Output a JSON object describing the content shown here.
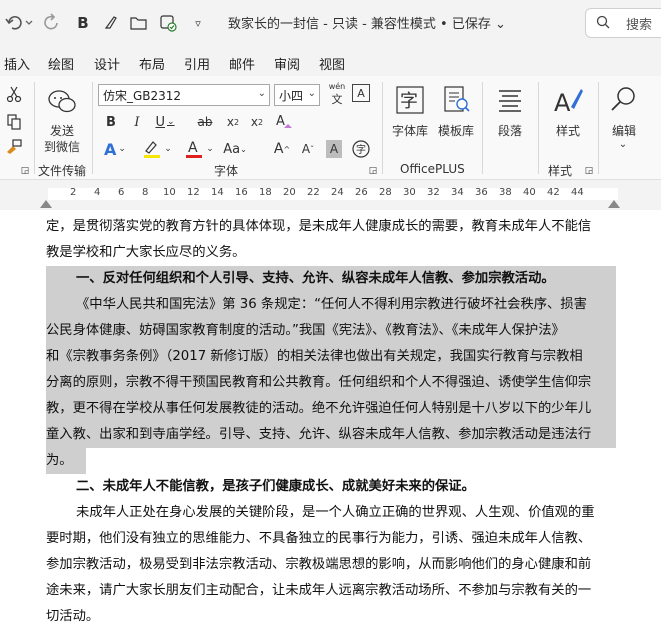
{
  "titlebar": {
    "document_title": "致家长的一封信  -  只读  -  兼容性模式 • 已保存 ⌄",
    "search_label": "搜索"
  },
  "menu": {
    "tabs": [
      "插入",
      "绘图",
      "设计",
      "布局",
      "引用",
      "邮件",
      "审阅",
      "视图"
    ]
  },
  "ribbon": {
    "send_wechat_line1": "发送",
    "send_wechat_line2": "到微信",
    "file_transfer_group": "文件传输",
    "font_name": "仿宋_GB2312",
    "font_size": "小四",
    "wen_label": "wén",
    "font_group": "字体",
    "font_lib": "字体库",
    "template_lib": "模板库",
    "officeplus_group": "OfficePLUS",
    "paragraph": "段落",
    "style": "样式",
    "style_group": "样式",
    "edit": "编辑"
  },
  "ruler": {
    "numbers": [
      "2",
      "4",
      "6",
      "8",
      "10",
      "12",
      "14",
      "16",
      "18",
      "20",
      "22",
      "24",
      "26",
      "28",
      "30",
      "32",
      "34",
      "36",
      "38",
      "40",
      "42",
      "44"
    ]
  },
  "document": {
    "lines": [
      "定，是贯彻落实党的教育方针的具体体现，是未成年人健康成长的需要，教育未成年人不能信",
      "教是学校和广大家长应尽的义务。",
      "一、反对任何组织和个人引导、支持、允许、纵容未成年人信教、参加宗教活动。",
      "《中华人民共和国宪法》第 36 条规定：“任何人不得利用宗教进行破坏社会秩序、损害",
      "公民身体健康、妨碍国家教育制度的活动。”我国《宪法》、《教育法》、《未成年人保护法》",
      "和《宗教事务条例》（2017 新修订版）的相关法律也做出有关规定，我国实行教育与宗教相",
      "分离的原则，宗教不得干预国民教育和公共教育。任何组织和个人不得强迫、诱使学生信仰宗",
      "教，更不得在学校从事任何发展教徒的活动。绝不允许强迫任何人特别是十八岁以下的少年儿",
      "童入教、出家和到寺庙学经。引导、支持、允许、纵容未成年人信教、参加宗教活动是违法行",
      "为。",
      "二、未成年人不能信教，是孩子们健康成长、成就美好未来的保证。",
      "未成年人正处在身心发展的关键阶段，是一个人确立正确的世界观、人生观、价值观的重",
      "要时期，他们没有独立的思维能力、不具备独立的民事行为能力，引诱、强迫未成年人信教、",
      "参加宗教活动，极易受到非法宗教活动、宗教极端思想的影响，从而影响他们的身心健康和前",
      "途未来，请广大家长朋友们主动配合，让未成年人远离宗教活动场所、不参加与宗教有关的一",
      "切活动。"
    ]
  }
}
